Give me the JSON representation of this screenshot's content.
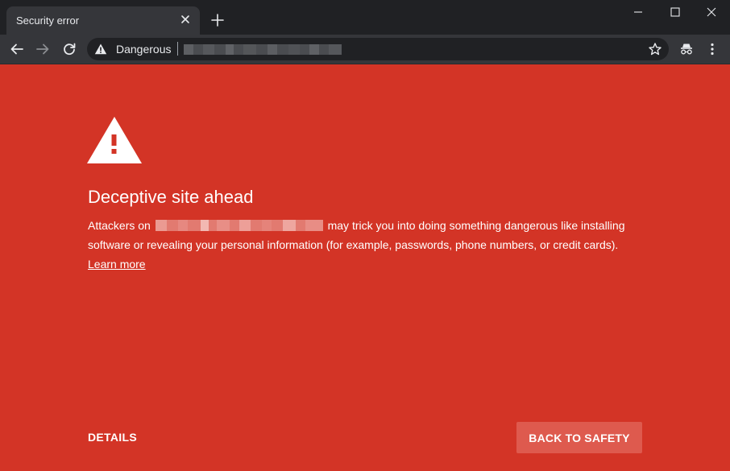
{
  "tab": {
    "title": "Security error",
    "close_icon": "close-icon",
    "new_tab_icon": "plus-icon"
  },
  "window_controls": {
    "minimize_icon": "minimize-icon",
    "maximize_icon": "maximize-icon",
    "close_icon": "close-icon"
  },
  "toolbar": {
    "back_icon": "arrow-left-icon",
    "forward_icon": "arrow-right-icon",
    "reload_icon": "reload-icon",
    "omnibox": {
      "security_icon": "warning-triangle-icon",
      "security_label": "Dangerous",
      "bookmark_icon": "star-icon"
    },
    "extension_icon": "incognito-icon",
    "menu_icon": "vertical-dots-icon"
  },
  "interstitial": {
    "warning_icon": "warning-triangle-icon",
    "heading": "Deceptive site ahead",
    "line1_prefix": "Attackers on",
    "line1_suffix": "may trick you into doing something dangerous like installing",
    "line2": "software or revealing your personal information (for example, passwords, phone numbers, or credit cards).",
    "learn_more": "Learn more",
    "details_button": "DETAILS",
    "back_to_safety_button": "BACK TO SAFETY"
  },
  "colors": {
    "page_background": "#d33426",
    "title_bar": "#202124",
    "toolbar": "#35363a",
    "omnibox": "#202124",
    "primary_button": "#de5a4e",
    "text": "#ffffff"
  }
}
